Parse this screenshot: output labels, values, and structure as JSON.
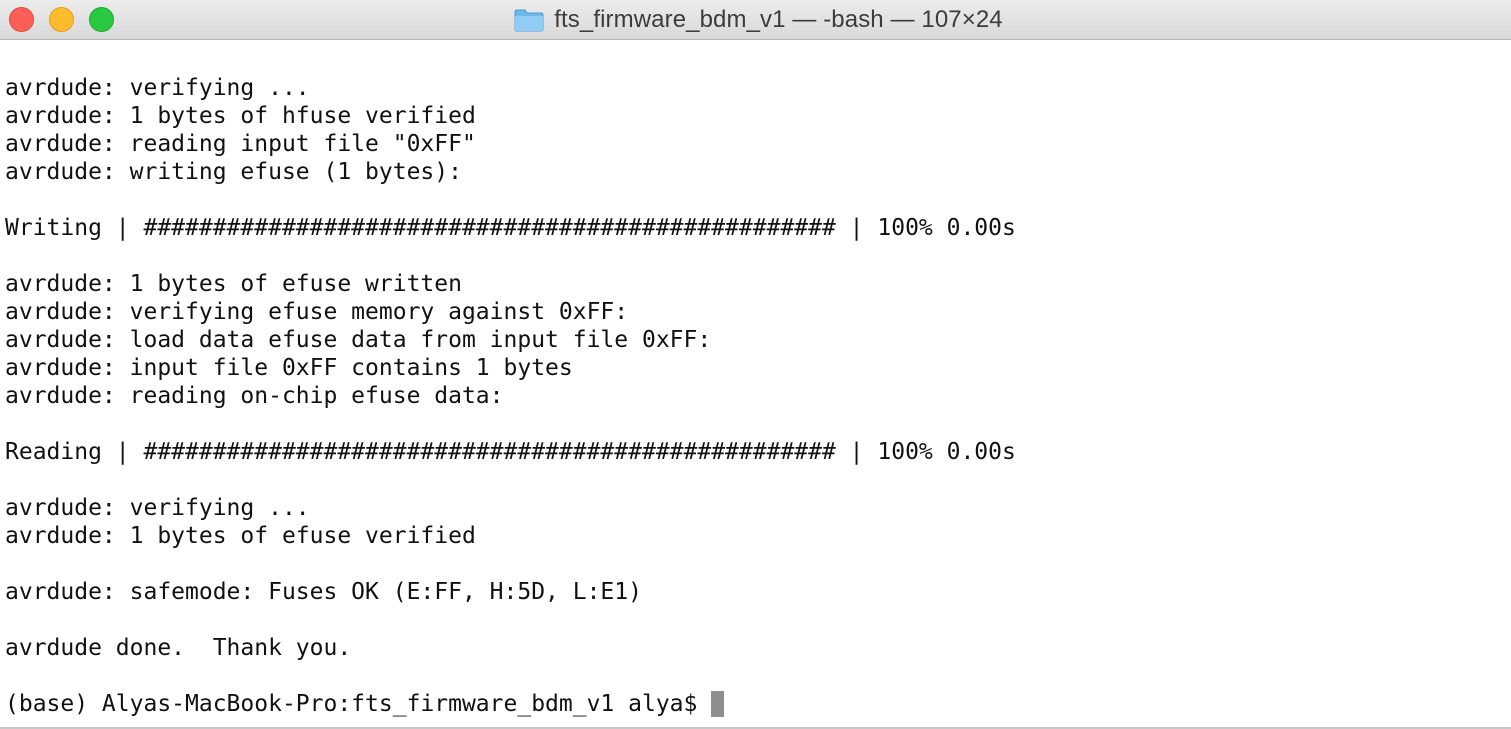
{
  "window": {
    "title": "fts_firmware_bdm_v1 — -bash — 107×24",
    "folder_icon": "folder-icon"
  },
  "terminal": {
    "lines": [
      "avrdude: verifying ...",
      "avrdude: 1 bytes of hfuse verified",
      "avrdude: reading input file \"0xFF\"",
      "avrdude: writing efuse (1 bytes):",
      "",
      "Writing | ################################################## | 100% 0.00s",
      "",
      "avrdude: 1 bytes of efuse written",
      "avrdude: verifying efuse memory against 0xFF:",
      "avrdude: load data efuse data from input file 0xFF:",
      "avrdude: input file 0xFF contains 1 bytes",
      "avrdude: reading on-chip efuse data:",
      "",
      "Reading | ################################################## | 100% 0.00s",
      "",
      "avrdude: verifying ...",
      "avrdude: 1 bytes of efuse verified",
      "",
      "avrdude: safemode: Fuses OK (E:FF, H:5D, L:E1)",
      "",
      "avrdude done.  Thank you.",
      ""
    ],
    "prompt": "(base) Alyas-MacBook-Pro:fts_firmware_bdm_v1 alya$ "
  },
  "colors": {
    "close": "#fd5f57",
    "minimize": "#fdbc2e",
    "maximize": "#28c840",
    "folder": "#7cc0ee"
  }
}
